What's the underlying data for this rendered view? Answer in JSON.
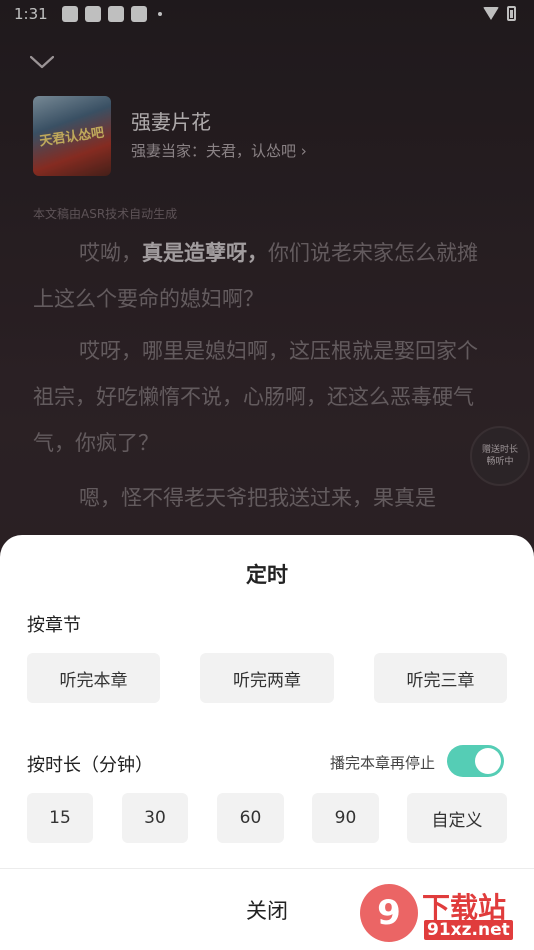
{
  "status_bar": {
    "time": "1:31"
  },
  "player": {
    "book_title": "强妻片花",
    "book_subtitle": "强妻当家：夫君，认怂吧 ›",
    "cover_text": "天君认怂吧",
    "asr_note": "本文稿由ASR技术自动生成",
    "paragraphs": [
      {
        "before": "哎呦，",
        "bold": "真是造孽呀，",
        "after": "你们说老宋家怎么就摊上这么个要命的媳妇啊？"
      },
      {
        "text": "哎呀，哪里是媳妇啊，这压根就是娶回家个祖宗，好吃懒惰不说，心肠啊，还这么恶毒硬气气，你疯了？"
      },
      {
        "text": "嗯，怪不得老天爷把我送过来，果真是"
      }
    ],
    "gift_bubble": {
      "line1": "赠送时长",
      "line2": "畅听中"
    }
  },
  "timer_sheet": {
    "title": "定时",
    "by_chapter_label": "按章节",
    "chapter_options": [
      "听完本章",
      "听完两章",
      "听完三章"
    ],
    "by_duration_label": "按时长（分钟）",
    "stop_after_chapter_label": "播完本章再停止",
    "stop_after_chapter_enabled": true,
    "duration_options": [
      "15",
      "30",
      "60",
      "90",
      "自定义"
    ],
    "close_label": "关闭",
    "accent_color": "#55cdb5"
  },
  "watermark": {
    "char": "9",
    "text": "下载站",
    "url": "91xz.net"
  }
}
